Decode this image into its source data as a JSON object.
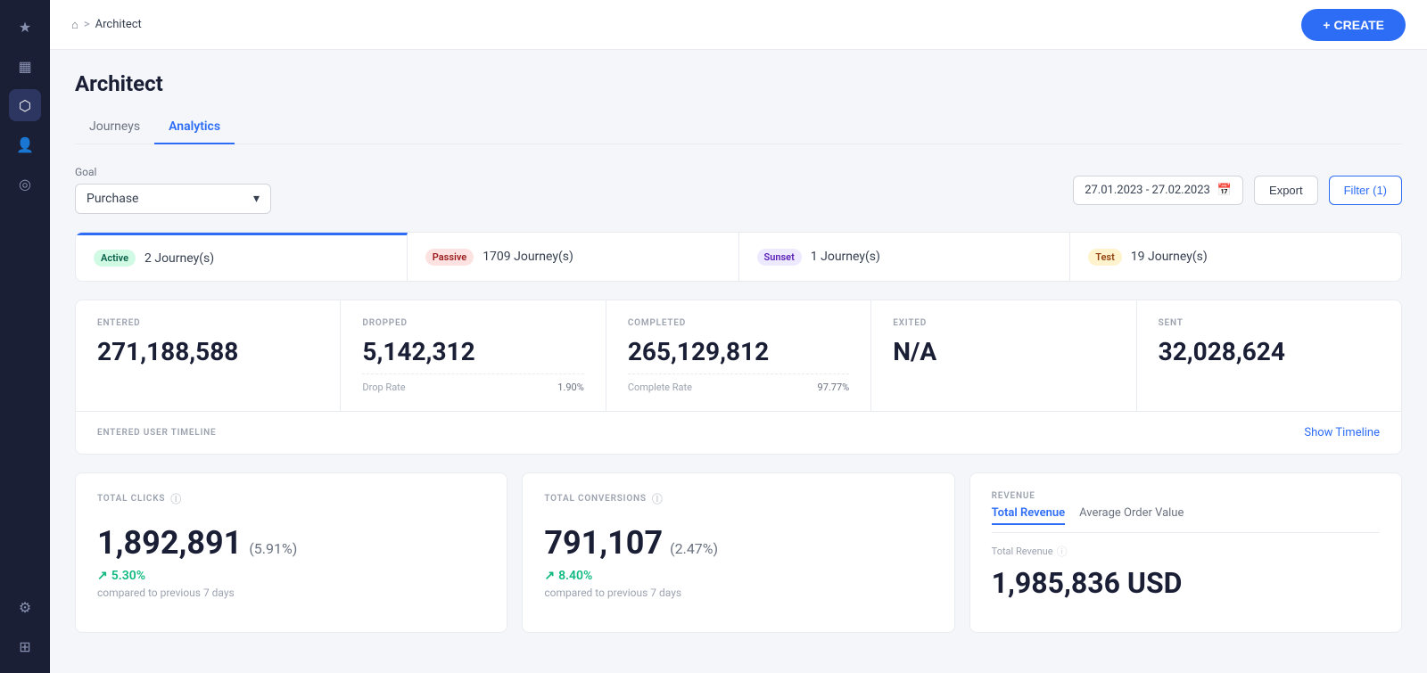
{
  "sidebar": {
    "icons": [
      {
        "name": "star-icon",
        "symbol": "★",
        "active": false
      },
      {
        "name": "analytics-icon",
        "symbol": "▦",
        "active": false
      },
      {
        "name": "journeys-icon",
        "symbol": "⬡",
        "active": true
      },
      {
        "name": "users-icon",
        "symbol": "👤",
        "active": false
      },
      {
        "name": "location-icon",
        "symbol": "◎",
        "active": false
      },
      {
        "name": "settings-icon",
        "symbol": "⚙",
        "active": false
      },
      {
        "name": "grid-icon",
        "symbol": "⊞",
        "active": false
      }
    ]
  },
  "header": {
    "breadcrumb_home": "⌂",
    "breadcrumb_separator": ">",
    "breadcrumb_current": "Architect",
    "page_title": "Architect",
    "create_button": "+ CREATE"
  },
  "tabs": [
    {
      "id": "journeys",
      "label": "Journeys",
      "active": false
    },
    {
      "id": "analytics",
      "label": "Analytics",
      "active": true
    }
  ],
  "controls": {
    "goal_label": "Goal",
    "goal_value": "Purchase",
    "date_range": "27.01.2023 - 27.02.2023",
    "export_label": "Export",
    "filter_label": "Filter (1)"
  },
  "status_cards": [
    {
      "badge": "Active",
      "badge_type": "active",
      "journeys": "2 Journey(s)"
    },
    {
      "badge": "Passive",
      "badge_type": "passive",
      "journeys": "1709 Journey(s)"
    },
    {
      "badge": "Sunset",
      "badge_type": "sunset",
      "journeys": "1 Journey(s)"
    },
    {
      "badge": "Test",
      "badge_type": "test",
      "journeys": "19 Journey(s)"
    }
  ],
  "metrics": [
    {
      "label": "ENTERED",
      "value": "271,188,588",
      "sub_label": null,
      "sub_value": null
    },
    {
      "label": "DROPPED",
      "value": "5,142,312",
      "sub_label": "Drop Rate",
      "sub_value": "1.90%"
    },
    {
      "label": "COMPLETED",
      "value": "265,129,812",
      "sub_label": "Complete Rate",
      "sub_value": "97.77%"
    },
    {
      "label": "EXITED",
      "value": "N/A",
      "sub_label": null,
      "sub_value": null
    },
    {
      "label": "SENT",
      "value": "32,028,624",
      "sub_label": null,
      "sub_value": null
    }
  ],
  "timeline": {
    "label": "ENTERED USER TIMELINE",
    "show_link": "Show Timeline"
  },
  "bottom_cards": {
    "total_clicks": {
      "title": "TOTAL CLICKS",
      "value": "1,892,891",
      "pct": "(5.91%)",
      "trend": "5.30%",
      "trend_label": "compared to previous 7 days"
    },
    "total_conversions": {
      "title": "TOTAL CONVERSIONS",
      "value": "791,107",
      "pct": "(2.47%)",
      "trend": "8.40%",
      "trend_label": "compared to previous 7 days"
    },
    "revenue": {
      "title": "REVENUE",
      "tab_total": "Total Revenue",
      "tab_aov": "Average Order Value",
      "sub_label": "Total Revenue",
      "value": "1,985,836 USD"
    }
  }
}
